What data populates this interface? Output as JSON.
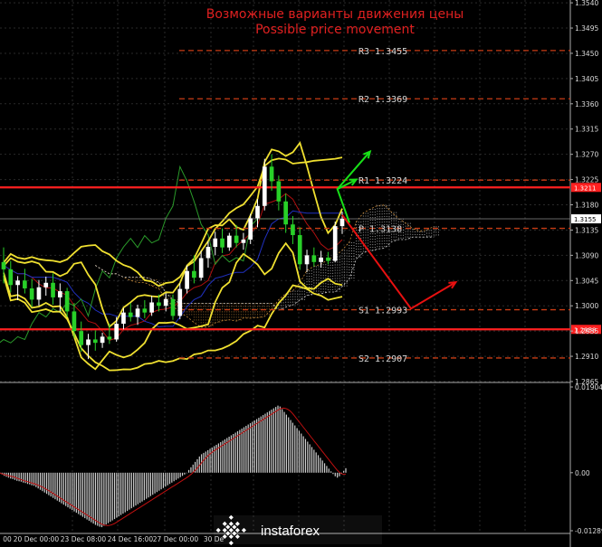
{
  "chart_data": {
    "type": "line",
    "title": "Возможные варианты движения цены",
    "subtitle": "Possible price movement",
    "ylim": [
      1.2865,
      1.3545
    ],
    "y_ticks": [
      "1.3540",
      "1.3495",
      "1.3450",
      "1.3405",
      "1.3360",
      "1.3315",
      "1.3270",
      "1.3225",
      "1.3180",
      "1.3135",
      "1.3090",
      "1.3045",
      "1.3000",
      "1.2955",
      "1.2910",
      "1.2865"
    ],
    "x_tick_labels": [
      "00",
      "20 Dec 00:00",
      "23 Dec 08:00",
      "24 Dec 16:00",
      "27 Dec 00:00",
      "30 De"
    ],
    "current_price": "1.3155",
    "red_line_upper_label": "1.3211",
    "red_line_lower_label": "1.2958",
    "red_line_upper": 1.3211,
    "red_line_lower": 1.2958,
    "pivot_levels": [
      {
        "label": "R3 1.3455",
        "value": 1.3455
      },
      {
        "label": "R2 1.3369",
        "value": 1.3369
      },
      {
        "label": "R1 1.3224",
        "value": 1.3224
      },
      {
        "label": "P  1.3138",
        "value": 1.3138
      },
      {
        "label": "S1 1.2993",
        "value": 1.2993
      },
      {
        "label": "S2 1.2907",
        "value": 1.2907
      }
    ],
    "candles": [
      [
        1.3078,
        1.3104,
        1.304,
        1.3065
      ],
      [
        1.3065,
        1.308,
        1.3024,
        1.3037
      ],
      [
        1.3037,
        1.3053,
        1.301,
        1.3045
      ],
      [
        1.3045,
        1.3066,
        1.3022,
        1.3031
      ],
      [
        1.3031,
        1.3048,
        1.2998,
        1.3011
      ],
      [
        1.3011,
        1.3046,
        1.3,
        1.3033
      ],
      [
        1.3033,
        1.3052,
        1.3018,
        1.3041
      ],
      [
        1.3041,
        1.3058,
        1.3002,
        1.3015
      ],
      [
        1.3015,
        1.304,
        1.299,
        1.3026
      ],
      [
        1.3026,
        1.3032,
        1.298,
        1.299
      ],
      [
        1.299,
        1.3005,
        1.2943,
        1.2955
      ],
      [
        1.2955,
        1.2972,
        1.2918,
        1.293
      ],
      [
        1.293,
        1.295,
        1.2905,
        1.294
      ],
      [
        1.294,
        1.2956,
        1.292,
        1.2934
      ],
      [
        1.2934,
        1.2952,
        1.2925,
        1.2945
      ],
      [
        1.2945,
        1.2968,
        1.2932,
        1.294
      ],
      [
        1.294,
        1.298,
        1.2936,
        1.2968
      ],
      [
        1.2968,
        1.2996,
        1.2958,
        1.2988
      ],
      [
        1.2988,
        1.3005,
        1.2972,
        1.298
      ],
      [
        1.298,
        1.3002,
        1.2966,
        1.2995
      ],
      [
        1.2995,
        1.301,
        1.2978,
        1.2988
      ],
      [
        1.2988,
        1.3018,
        1.2982,
        1.3006
      ],
      [
        1.3006,
        1.302,
        1.299,
        1.3
      ],
      [
        1.3,
        1.3022,
        1.299,
        1.3012
      ],
      [
        1.3012,
        1.302,
        1.2975,
        1.2982
      ],
      [
        1.2982,
        1.304,
        1.2976,
        1.303
      ],
      [
        1.303,
        1.3072,
        1.3022,
        1.3062
      ],
      [
        1.3062,
        1.309,
        1.304,
        1.305
      ],
      [
        1.305,
        1.3098,
        1.3045,
        1.3085
      ],
      [
        1.3085,
        1.3115,
        1.3068,
        1.3105
      ],
      [
        1.3105,
        1.3132,
        1.309,
        1.312
      ],
      [
        1.312,
        1.3138,
        1.3094,
        1.3104
      ],
      [
        1.3104,
        1.313,
        1.3098,
        1.3125
      ],
      [
        1.3125,
        1.3144,
        1.3104,
        1.3112
      ],
      [
        1.3112,
        1.313,
        1.31,
        1.3118
      ],
      [
        1.3118,
        1.3164,
        1.311,
        1.3156
      ],
      [
        1.3156,
        1.319,
        1.314,
        1.3178
      ],
      [
        1.3178,
        1.3262,
        1.317,
        1.3248
      ],
      [
        1.3248,
        1.327,
        1.3205,
        1.3222
      ],
      [
        1.3222,
        1.3232,
        1.317,
        1.3186
      ],
      [
        1.3186,
        1.32,
        1.313,
        1.3145
      ],
      [
        1.3145,
        1.316,
        1.311,
        1.3126
      ],
      [
        1.3126,
        1.314,
        1.3064,
        1.3074
      ],
      [
        1.3074,
        1.31,
        1.306,
        1.309
      ],
      [
        1.309,
        1.3104,
        1.307,
        1.3078
      ],
      [
        1.3078,
        1.3098,
        1.3068,
        1.3086
      ],
      [
        1.3086,
        1.3096,
        1.3074,
        1.308
      ],
      [
        1.308,
        1.315,
        1.3078,
        1.3142
      ],
      [
        1.3142,
        1.3168,
        1.3128,
        1.3155
      ]
    ],
    "arrows": [
      {
        "color": "#18e018",
        "points": [
          [
            1.3148,
            0
          ],
          [
            1.3208,
            -0.035
          ],
          [
            1.3225,
            0.02
          ]
        ]
      },
      {
        "color": "#18e018",
        "points": [
          [
            1.3208,
            -0.035
          ],
          [
            1.3275,
            0.06
          ]
        ]
      },
      {
        "color": "#e81010",
        "points": [
          [
            1.3162,
            0
          ],
          [
            1.2995,
            0.2
          ],
          [
            1.3042,
            0.33
          ]
        ]
      }
    ],
    "histogram_ylim": [
      -0.01289,
      0.01904
    ],
    "histogram_ticks": [
      "0.01904",
      "0.00",
      "-0.01289"
    ],
    "histogram": [
      -0.0001,
      -0.0002,
      -0.0003,
      -0.0004,
      -0.0005,
      -0.0006,
      -0.0007,
      -0.0008,
      -0.0009,
      -0.0009,
      -0.001,
      -0.0011,
      -0.0011,
      -0.0012,
      -0.0012,
      -0.0013,
      -0.0013,
      -0.0014,
      -0.0014,
      -0.0015,
      -0.0016,
      -0.0016,
      -0.0017,
      -0.0017,
      -0.0018,
      -0.0018,
      -0.0019,
      -0.0019,
      -0.0019,
      -0.002,
      -0.002,
      -0.0021,
      -0.0021,
      -0.0022,
      -0.0022,
      -0.0023,
      -0.0023,
      -0.0024,
      -0.0024,
      -0.0025,
      -0.0025,
      -0.0026,
      -0.0026,
      -0.0027,
      -0.0027,
      -0.0028,
      -0.0028,
      -0.0029,
      -0.0029,
      -0.003,
      -0.0031,
      -0.0032,
      -0.0033,
      -0.0034,
      -0.0035,
      -0.0036,
      -0.0037,
      -0.0038,
      -0.0039,
      -0.004,
      -0.0041,
      -0.0042,
      -0.0043,
      -0.0044,
      -0.0045,
      -0.0046,
      -0.0047,
      -0.0048,
      -0.0049,
      -0.005,
      -0.0051,
      -0.0052,
      -0.0053,
      -0.0054,
      -0.0055,
      -0.0056,
      -0.0057,
      -0.0058,
      -0.0059,
      -0.006,
      -0.0061,
      -0.0062,
      -0.0063,
      -0.0064,
      -0.0065,
      -0.0066,
      -0.0067,
      -0.0068,
      -0.0069,
      -0.007,
      -0.0071,
      -0.0072,
      -0.0073,
      -0.0074,
      -0.0075,
      -0.0076,
      -0.0077,
      -0.0078,
      -0.0079,
      -0.008,
      -0.0081,
      -0.0082,
      -0.0083,
      -0.0084,
      -0.0085,
      -0.0086,
      -0.0087,
      -0.0088,
      -0.0089,
      -0.009,
      -0.0091,
      -0.0092,
      -0.0093,
      -0.0094,
      -0.0095,
      -0.0096,
      -0.0097,
      -0.0098,
      -0.0099,
      -0.01,
      -0.0101,
      -0.0102,
      -0.0103,
      -0.0104,
      -0.0105,
      -0.0106,
      -0.0107,
      -0.0108,
      -0.0109,
      -0.011,
      -0.0111,
      -0.0112,
      -0.0113,
      -0.0114,
      -0.0115,
      -0.0116,
      -0.0117,
      -0.0118,
      -0.0118,
      -0.0119,
      -0.0119,
      -0.012,
      -0.012,
      -0.0121,
      -0.0121,
      -0.012,
      -0.0119,
      -0.0118,
      -0.0117,
      -0.0116,
      -0.0115,
      -0.0114,
      -0.0113,
      -0.0112,
      -0.0111,
      -0.011,
      -0.0109,
      -0.0108,
      -0.0107,
      -0.0106,
      -0.0105,
      -0.0104,
      -0.0103,
      -0.0102,
      -0.0101,
      -0.01,
      -0.0099,
      -0.0098,
      -0.0097,
      -0.0096,
      -0.0095,
      -0.0094,
      -0.0093,
      -0.0092,
      -0.0091,
      -0.009,
      -0.0089,
      -0.0088,
      -0.0087,
      -0.0086,
      -0.0085,
      -0.0084,
      -0.0083,
      -0.0082,
      -0.0081,
      -0.008,
      -0.0079,
      -0.0078,
      -0.0077,
      -0.0076,
      -0.0075,
      -0.0074,
      -0.0073,
      -0.0072,
      -0.0071,
      -0.007,
      -0.0069,
      -0.0068,
      -0.0067,
      -0.0066,
      -0.0065,
      -0.0064,
      -0.0063,
      -0.0062,
      -0.0061,
      -0.006,
      -0.0059,
      -0.0058,
      -0.0057,
      -0.0056,
      -0.0055,
      -0.0054,
      -0.0053,
      -0.0052,
      -0.0051,
      -0.005,
      -0.0049,
      -0.0048,
      -0.0047,
      -0.0046,
      -0.0045,
      -0.0044,
      -0.0043,
      -0.0042,
      -0.0041,
      -0.004,
      -0.0039,
      -0.0038,
      -0.0037,
      -0.0036,
      -0.0035,
      -0.0034,
      -0.0033,
      -0.0032,
      -0.0031,
      -0.003,
      -0.0029,
      -0.0028,
      -0.0027,
      -0.0026,
      -0.0025,
      -0.0024,
      -0.0023,
      -0.0022,
      -0.0021,
      -0.002,
      -0.0019,
      -0.0018,
      -0.0017,
      -0.0016,
      -0.0015,
      -0.0014,
      -0.0013,
      -0.0012,
      -0.0011,
      -0.001,
      -0.0009,
      -0.0008,
      -0.0007,
      -0.0006,
      -0.0005,
      -0.0004,
      -0.0003,
      -0.0002,
      -0.0001,
      0.0002,
      0.0004,
      0.0006,
      0.0008,
      0.001,
      0.0012,
      0.0014,
      0.0016,
      0.0018,
      0.002,
      0.0022,
      0.0024,
      0.0026,
      0.0028,
      0.003,
      0.0032,
      0.0034,
      0.0036,
      0.0038,
      0.004,
      0.0041,
      0.0042,
      0.0043,
      0.0044,
      0.0045,
      0.0046,
      0.0047,
      0.0048,
      0.0049,
      0.005,
      0.0051,
      0.0052,
      0.0053,
      0.0054,
      0.0055,
      0.0056,
      0.0057,
      0.0058,
      0.0059,
      0.006,
      0.0061,
      0.0062,
      0.0063,
      0.0064,
      0.0065,
      0.0066,
      0.0067,
      0.0068,
      0.0069,
      0.007,
      0.0071,
      0.0072,
      0.0073,
      0.0074,
      0.0075,
      0.0076,
      0.0077,
      0.0078,
      0.0079,
      0.008,
      0.0081,
      0.0082,
      0.0083,
      0.0084,
      0.0085,
      0.0086,
      0.0087,
      0.0088,
      0.0089,
      0.009,
      0.0091,
      0.0092,
      0.0093,
      0.0094,
      0.0095,
      0.0096,
      0.0097,
      0.0098,
      0.0099,
      0.01,
      0.0101,
      0.0102,
      0.0103,
      0.0104,
      0.0105,
      0.0106,
      0.0107,
      0.0108,
      0.0109,
      0.011,
      0.0111,
      0.0112,
      0.0113,
      0.0114,
      0.0115,
      0.0116,
      0.0117,
      0.0118,
      0.0119,
      0.012,
      0.0121,
      0.0122,
      0.0123,
      0.0124,
      0.0125,
      0.0126,
      0.0127,
      0.0128,
      0.0129,
      0.013,
      0.0131,
      0.0132,
      0.0133,
      0.0134,
      0.0135,
      0.0136,
      0.0137,
      0.0138,
      0.0139,
      0.014,
      0.0141,
      0.0142,
      0.0143,
      0.0144,
      0.0145,
      0.0146,
      0.0147,
      0.0148,
      0.0149,
      0.015,
      0.0149,
      0.0147,
      0.0145,
      0.0143,
      0.0141,
      0.0139,
      0.0137,
      0.0135,
      0.0133,
      0.0131,
      0.0129,
      0.0127,
      0.0125,
      0.0123,
      0.0121,
      0.0119,
      0.0117,
      0.0115,
      0.0113,
      0.0111,
      0.0109,
      0.0107,
      0.0105,
      0.0103,
      0.0101,
      0.0099,
      0.0097,
      0.0095,
      0.0093,
      0.0091,
      0.0089,
      0.0087,
      0.0085,
      0.0083,
      0.0081,
      0.0079,
      0.0077,
      0.0075,
      0.0073,
      0.0071,
      0.0069,
      0.0067,
      0.0065,
      0.0063,
      0.0061,
      0.0059,
      0.0057,
      0.0055,
      0.0053,
      0.0051,
      0.0049,
      0.0047,
      0.0045,
      0.0043,
      0.0041,
      0.0039,
      0.0037,
      0.0035,
      0.0033,
      0.0031,
      0.0029,
      0.0027,
      0.0025,
      0.0023,
      0.0021,
      0.0019,
      0.0017,
      0.0015,
      0.0013,
      0.0011,
      0.0009,
      0.0007,
      0.0005,
      0.0003,
      0.0001,
      -0.0001,
      -0.0003,
      -0.0005,
      -0.0007,
      -0.0008,
      -0.0009,
      -0.001,
      -0.0011,
      -0.001,
      -0.0009,
      -0.0008,
      -0.0006,
      -0.0004,
      -0.0002,
      0.0,
      0.0002,
      0.0004,
      0.0006,
      0.0008,
      0.001
    ]
  },
  "colors": {
    "background": "#000000",
    "candle_up": "#ffffff",
    "candle_down": "#28d028",
    "red_line": "#ff2020",
    "pivot_dash": "#c83c14",
    "bollinger": "#f0e030",
    "ichimoku_green": "#2a9a2a",
    "ichimoku_blue": "#2030c0",
    "ichimoku_red": "#b01010",
    "cloud_up": "#cfcfcf",
    "cloud_down": "#c88a3a",
    "hist_bar": "#d0d0d0",
    "signal_line": "#c01010"
  },
  "watermark": "instaforex"
}
